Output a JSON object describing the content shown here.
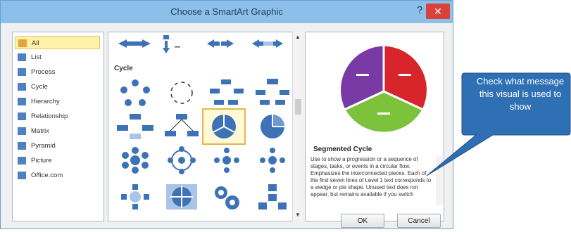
{
  "dialog": {
    "title": "Choose a SmartArt Graphic",
    "help": "?",
    "close": "✕"
  },
  "categories": [
    {
      "label": "All",
      "icon": "all-icon"
    },
    {
      "label": "List",
      "icon": "list-icon"
    },
    {
      "label": "Process",
      "icon": "process-icon"
    },
    {
      "label": "Cycle",
      "icon": "cycle-icon"
    },
    {
      "label": "Hierarchy",
      "icon": "hierarchy-icon"
    },
    {
      "label": "Relationship",
      "icon": "relationship-icon"
    },
    {
      "label": "Matrix",
      "icon": "matrix-icon"
    },
    {
      "label": "Pyramid",
      "icon": "pyramid-icon"
    },
    {
      "label": "Picture",
      "icon": "picture-icon"
    },
    {
      "label": "Office.com",
      "icon": "office-com-icon"
    }
  ],
  "gallery": {
    "section_title": "Cycle"
  },
  "preview": {
    "title": "Segmented Cycle",
    "description": "Use to show a progression or a sequence of stages, tasks, or events in a circular flow. Emphasizes the interconnected pieces. Each of the first seven lines of Level 1 text corresponds to a wedge or pie shape. Unused text does not appear, but remains available if you switch"
  },
  "buttons": {
    "ok": "OK",
    "cancel": "Cancel"
  },
  "callout": {
    "text": "Check what message this visual is used to show"
  },
  "colors": {
    "titlebar": "#8cc0ea",
    "callout": "#2f6fb3",
    "wedge_red": "#d8242b",
    "wedge_green": "#7cc23a",
    "wedge_purple": "#7a3aa6"
  }
}
